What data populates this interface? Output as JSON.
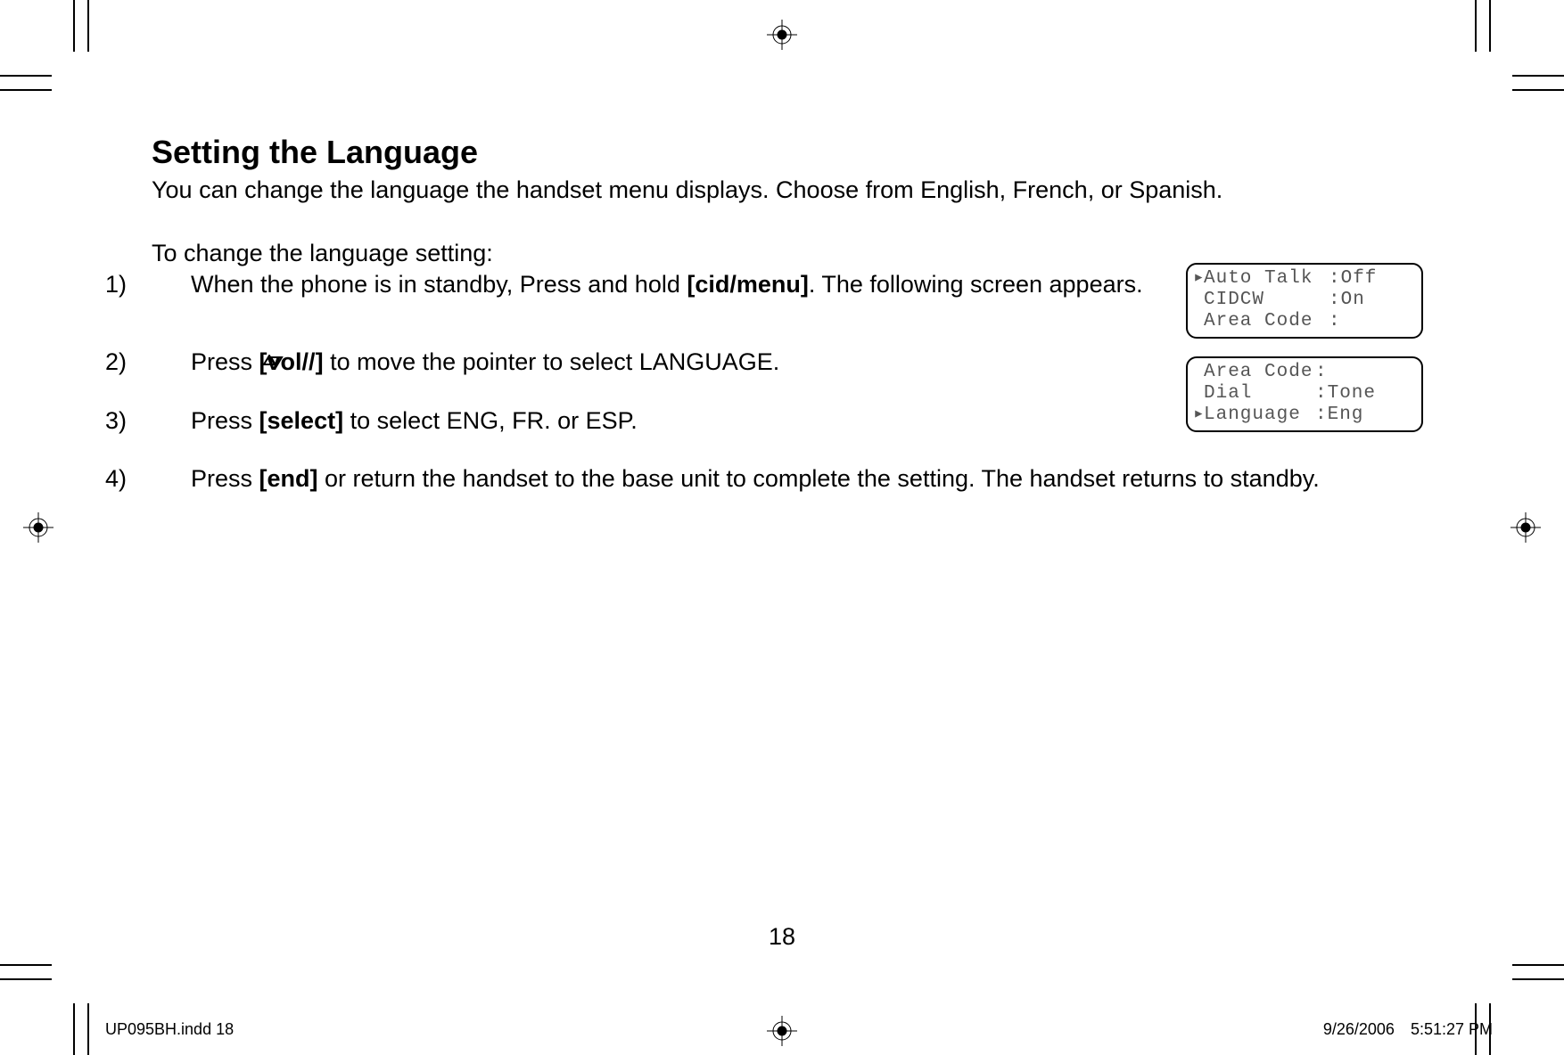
{
  "title": "Setting the Language",
  "intro": "You can change the language the handset menu displays. Choose from English, French, or Spanish.",
  "lead": "To change the language setting:",
  "steps": {
    "s1": {
      "num": "1)",
      "pre": "When the phone is in standby, Press and hold ",
      "button": "[cid/menu]",
      "post": ". The following screen appears."
    },
    "s2": {
      "num": "2)",
      "pre": "Press ",
      "button_open": "[vol/",
      "button_close": "]",
      "post": " to move the pointer to select LANGUAGE."
    },
    "s3": {
      "num": "3)",
      "pre": "Press ",
      "button": "[select]",
      "post": " to select ENG, FR. or ESP."
    },
    "s4": {
      "num": "4)",
      "pre": "Press ",
      "button": "[end]",
      "post": " or return the handset to the base unit to complete the setting. The handset returns to standby."
    }
  },
  "lcd1": {
    "r1": {
      "ptr": "▸",
      "label": "Auto Talk",
      "value": ":Off"
    },
    "r2": {
      "ptr": " ",
      "label": "CIDCW",
      "value": ":On"
    },
    "r3": {
      "ptr": " ",
      "label": "Area Code",
      "value": ":"
    }
  },
  "lcd2": {
    "r1": {
      "ptr": " ",
      "label": "Area Code",
      "value": ":"
    },
    "r2": {
      "ptr": " ",
      "label": "Dial",
      "value": ":Tone"
    },
    "r3": {
      "ptr": "▸",
      "label": "Language",
      "value": ":Eng"
    }
  },
  "page_number": "18",
  "footer": {
    "file": "UP095BH.indd   18",
    "date": "9/26/2006",
    "time": "5:51:27 PM"
  }
}
